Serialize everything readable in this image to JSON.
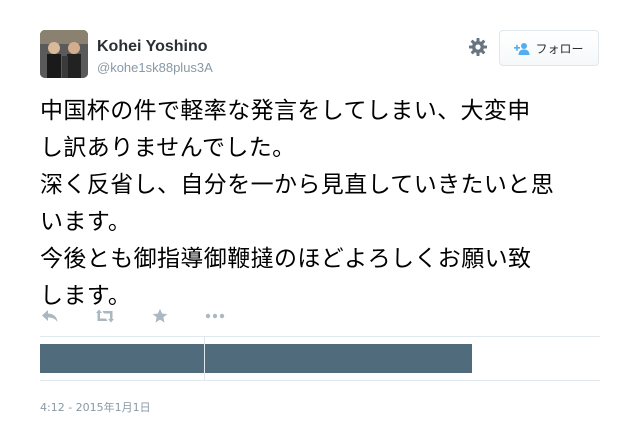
{
  "user": {
    "display_name": "Kohei Yoshino",
    "screen_name": "@kohe1sk88plus3A"
  },
  "follow_button": {
    "label": "フォロー",
    "icon": "person-plus-icon"
  },
  "settings_icon": "gear-icon",
  "tweet": {
    "lines": [
      "中国杯の件で軽率な発言をしてしまい、大変申",
      "し訳ありませんでした。",
      "深く反省し、自分を一から見直していきたいと思",
      "います。",
      "今後とも御指導御鞭撻のほどよろしくお願い致",
      "します。"
    ]
  },
  "actions": [
    "reply-icon",
    "retweet-icon",
    "favorite-icon",
    "more-icon"
  ],
  "timestamp": "4:12 - 2015年1月1日",
  "colors": {
    "accent": "#55acee",
    "muted": "#8899a6",
    "icon": "#aab8c2",
    "stat_bar": "#506b7c",
    "border": "#e1e8ed"
  }
}
